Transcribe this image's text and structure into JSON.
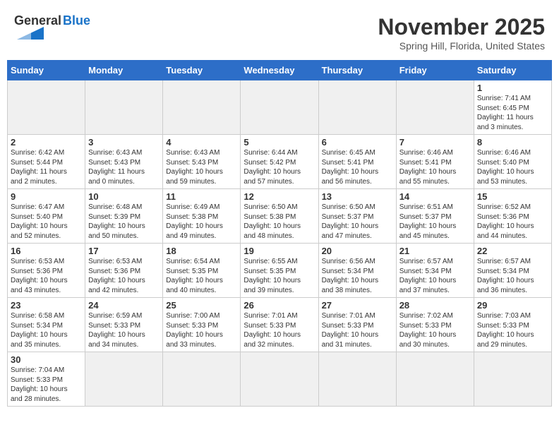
{
  "header": {
    "logo_general": "General",
    "logo_blue": "Blue",
    "month_title": "November 2025",
    "location": "Spring Hill, Florida, United States"
  },
  "days_of_week": [
    "Sunday",
    "Monday",
    "Tuesday",
    "Wednesday",
    "Thursday",
    "Friday",
    "Saturday"
  ],
  "weeks": [
    [
      {
        "day": "",
        "info": "",
        "empty": true
      },
      {
        "day": "",
        "info": "",
        "empty": true
      },
      {
        "day": "",
        "info": "",
        "empty": true
      },
      {
        "day": "",
        "info": "",
        "empty": true
      },
      {
        "day": "",
        "info": "",
        "empty": true
      },
      {
        "day": "",
        "info": "",
        "empty": true
      },
      {
        "day": "1",
        "info": "Sunrise: 7:41 AM\nSunset: 6:45 PM\nDaylight: 11 hours\nand 3 minutes."
      }
    ],
    [
      {
        "day": "2",
        "info": "Sunrise: 6:42 AM\nSunset: 5:44 PM\nDaylight: 11 hours\nand 2 minutes."
      },
      {
        "day": "3",
        "info": "Sunrise: 6:43 AM\nSunset: 5:43 PM\nDaylight: 11 hours\nand 0 minutes."
      },
      {
        "day": "4",
        "info": "Sunrise: 6:43 AM\nSunset: 5:43 PM\nDaylight: 10 hours\nand 59 minutes."
      },
      {
        "day": "5",
        "info": "Sunrise: 6:44 AM\nSunset: 5:42 PM\nDaylight: 10 hours\nand 57 minutes."
      },
      {
        "day": "6",
        "info": "Sunrise: 6:45 AM\nSunset: 5:41 PM\nDaylight: 10 hours\nand 56 minutes."
      },
      {
        "day": "7",
        "info": "Sunrise: 6:46 AM\nSunset: 5:41 PM\nDaylight: 10 hours\nand 55 minutes."
      },
      {
        "day": "8",
        "info": "Sunrise: 6:46 AM\nSunset: 5:40 PM\nDaylight: 10 hours\nand 53 minutes."
      }
    ],
    [
      {
        "day": "9",
        "info": "Sunrise: 6:47 AM\nSunset: 5:40 PM\nDaylight: 10 hours\nand 52 minutes."
      },
      {
        "day": "10",
        "info": "Sunrise: 6:48 AM\nSunset: 5:39 PM\nDaylight: 10 hours\nand 50 minutes."
      },
      {
        "day": "11",
        "info": "Sunrise: 6:49 AM\nSunset: 5:38 PM\nDaylight: 10 hours\nand 49 minutes."
      },
      {
        "day": "12",
        "info": "Sunrise: 6:50 AM\nSunset: 5:38 PM\nDaylight: 10 hours\nand 48 minutes."
      },
      {
        "day": "13",
        "info": "Sunrise: 6:50 AM\nSunset: 5:37 PM\nDaylight: 10 hours\nand 47 minutes."
      },
      {
        "day": "14",
        "info": "Sunrise: 6:51 AM\nSunset: 5:37 PM\nDaylight: 10 hours\nand 45 minutes."
      },
      {
        "day": "15",
        "info": "Sunrise: 6:52 AM\nSunset: 5:36 PM\nDaylight: 10 hours\nand 44 minutes."
      }
    ],
    [
      {
        "day": "16",
        "info": "Sunrise: 6:53 AM\nSunset: 5:36 PM\nDaylight: 10 hours\nand 43 minutes."
      },
      {
        "day": "17",
        "info": "Sunrise: 6:53 AM\nSunset: 5:36 PM\nDaylight: 10 hours\nand 42 minutes."
      },
      {
        "day": "18",
        "info": "Sunrise: 6:54 AM\nSunset: 5:35 PM\nDaylight: 10 hours\nand 40 minutes."
      },
      {
        "day": "19",
        "info": "Sunrise: 6:55 AM\nSunset: 5:35 PM\nDaylight: 10 hours\nand 39 minutes."
      },
      {
        "day": "20",
        "info": "Sunrise: 6:56 AM\nSunset: 5:34 PM\nDaylight: 10 hours\nand 38 minutes."
      },
      {
        "day": "21",
        "info": "Sunrise: 6:57 AM\nSunset: 5:34 PM\nDaylight: 10 hours\nand 37 minutes."
      },
      {
        "day": "22",
        "info": "Sunrise: 6:57 AM\nSunset: 5:34 PM\nDaylight: 10 hours\nand 36 minutes."
      }
    ],
    [
      {
        "day": "23",
        "info": "Sunrise: 6:58 AM\nSunset: 5:34 PM\nDaylight: 10 hours\nand 35 minutes."
      },
      {
        "day": "24",
        "info": "Sunrise: 6:59 AM\nSunset: 5:33 PM\nDaylight: 10 hours\nand 34 minutes."
      },
      {
        "day": "25",
        "info": "Sunrise: 7:00 AM\nSunset: 5:33 PM\nDaylight: 10 hours\nand 33 minutes."
      },
      {
        "day": "26",
        "info": "Sunrise: 7:01 AM\nSunset: 5:33 PM\nDaylight: 10 hours\nand 32 minutes."
      },
      {
        "day": "27",
        "info": "Sunrise: 7:01 AM\nSunset: 5:33 PM\nDaylight: 10 hours\nand 31 minutes."
      },
      {
        "day": "28",
        "info": "Sunrise: 7:02 AM\nSunset: 5:33 PM\nDaylight: 10 hours\nand 30 minutes."
      },
      {
        "day": "29",
        "info": "Sunrise: 7:03 AM\nSunset: 5:33 PM\nDaylight: 10 hours\nand 29 minutes."
      }
    ],
    [
      {
        "day": "30",
        "info": "Sunrise: 7:04 AM\nSunset: 5:33 PM\nDaylight: 10 hours\nand 28 minutes."
      },
      {
        "day": "",
        "info": "",
        "empty": true
      },
      {
        "day": "",
        "info": "",
        "empty": true
      },
      {
        "day": "",
        "info": "",
        "empty": true
      },
      {
        "day": "",
        "info": "",
        "empty": true
      },
      {
        "day": "",
        "info": "",
        "empty": true
      },
      {
        "day": "",
        "info": "",
        "empty": true
      }
    ]
  ]
}
